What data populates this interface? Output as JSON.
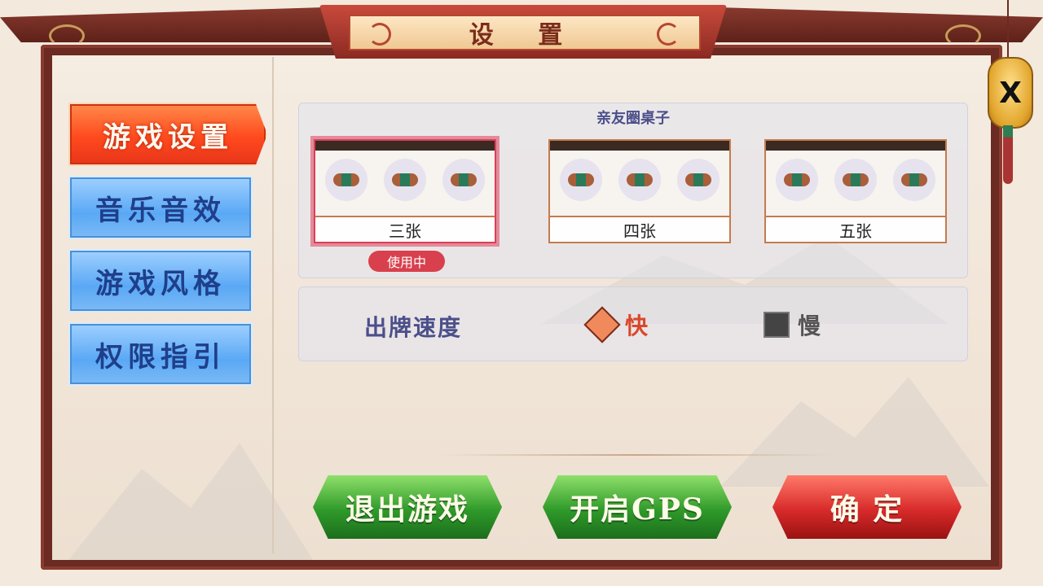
{
  "dialog": {
    "title": "设 置",
    "close_label": "X"
  },
  "sidebar": {
    "items": [
      {
        "label": "游戏设置",
        "active": true
      },
      {
        "label": "音乐音效",
        "active": false
      },
      {
        "label": "游戏风格",
        "active": false
      },
      {
        "label": "权限指引",
        "active": false
      }
    ]
  },
  "tables": {
    "title": "亲友圈桌子",
    "options": [
      {
        "label": "三张",
        "selected": true
      },
      {
        "label": "四张",
        "selected": false
      },
      {
        "label": "五张",
        "selected": false
      }
    ],
    "in_use_badge": "使用中"
  },
  "speed": {
    "label": "出牌速度",
    "options": [
      {
        "label": "快",
        "selected": true,
        "color": "#d9472b"
      },
      {
        "label": "慢",
        "selected": false,
        "color": "#555555"
      }
    ]
  },
  "actions": {
    "exit": "退出游戏",
    "gps": "开启GPS",
    "confirm": "确 定"
  },
  "colors": {
    "frame": "#6b2a22",
    "active_tab": "#ff4a1e",
    "tab": "#5aa8f5",
    "green_button": "#2f9a2a",
    "red_button": "#d82a2a"
  }
}
